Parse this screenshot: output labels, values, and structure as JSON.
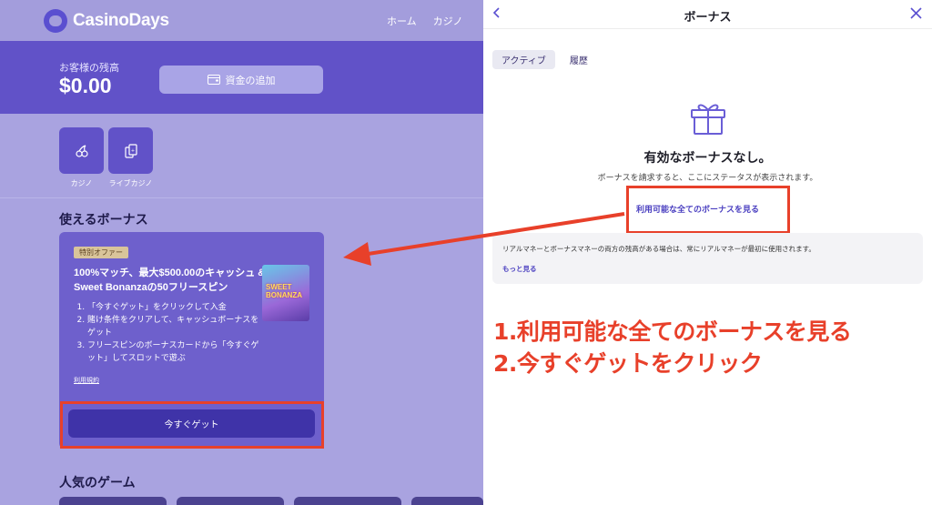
{
  "site": {
    "logo_text": "CasinoDays",
    "nav": [
      "ホーム",
      "カジノ"
    ]
  },
  "balance": {
    "label": "お客様の残高",
    "value": "$0.00",
    "deposit_label": "資金の追加"
  },
  "categories": [
    {
      "label": "カジノ",
      "icon": "cherry-icon"
    },
    {
      "label": "ライブカジノ",
      "icon": "cards-icon"
    }
  ],
  "bonus_section": {
    "title": "使えるボーナス",
    "card": {
      "tag": "特別オファー",
      "title": "100%マッチ、最大$500.00のキャッシュ & Sweet Bonanzaの50フリースピン",
      "thumb_text": "SWEET BONANZA",
      "steps": [
        "「今すぐゲット」をクリックして入金",
        "賭け条件をクリアして、キャッシュボーナスをゲット",
        "フリースピンのボーナスカードから「今すぐゲット」してスロットで遊ぶ"
      ],
      "terms": "利用規約",
      "cta": "今すぐゲット"
    }
  },
  "games_section": {
    "title": "人気のゲーム"
  },
  "panel": {
    "title": "ボーナス",
    "tabs": [
      {
        "label": "アクティブ",
        "active": true
      },
      {
        "label": "履歴",
        "active": false
      }
    ],
    "empty_title": "有効なボーナスなし。",
    "empty_sub": "ボーナスを請求すると、ここにステータスが表示されます。",
    "see_all": "利用可能な全てのボーナスを見る",
    "info_text": "リアルマネーとボーナスマネーの両方の残高がある場合は、常にリアルマネーが最初に使用されます。",
    "info_link": "もっと見る"
  },
  "annotation": {
    "line1": "1.利用可能な全てのボーナスを見る",
    "line2": "2.今すぐゲットをクリック",
    "color": "#e8402a"
  },
  "colors": {
    "brand": "#5a4fd0",
    "overlay": "#a9a3e0",
    "accent_red": "#e8402a"
  }
}
